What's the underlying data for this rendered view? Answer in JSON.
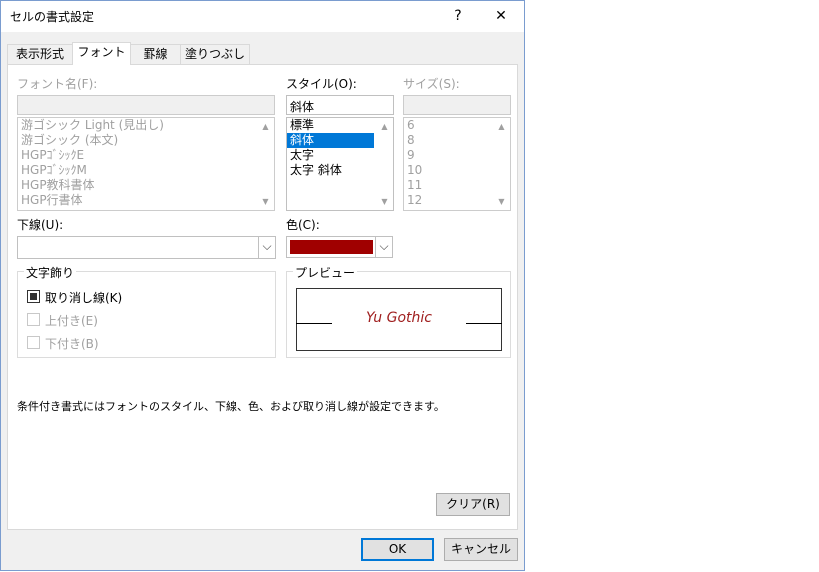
{
  "window": {
    "title": "セルの書式設定",
    "help_label": "?",
    "close_label": "✕"
  },
  "tabs": [
    {
      "label": "表示形式",
      "active": false
    },
    {
      "label": "フォント",
      "active": true
    },
    {
      "label": "罫線",
      "active": false
    },
    {
      "label": "塗りつぶし",
      "active": false
    }
  ],
  "font_name": {
    "label": "フォント名(F):",
    "value": "",
    "items": [
      "游ゴシック Light (見出し)",
      "游ゴシック (本文)",
      "HGPｺﾞｼｯｸE",
      "HGPｺﾞｼｯｸM",
      "HGP教科書体",
      "HGP行書体"
    ]
  },
  "style": {
    "label": "スタイル(O):",
    "value": "斜体",
    "items": [
      "標準",
      "斜体",
      "太字",
      "太字 斜体"
    ],
    "selected_index": 1
  },
  "size": {
    "label": "サイズ(S):",
    "value": "",
    "items": [
      "6",
      "8",
      "9",
      "10",
      "11",
      "12"
    ]
  },
  "underline": {
    "label": "下線(U):",
    "value": ""
  },
  "color": {
    "label": "色(C):",
    "value_hex": "#a00000"
  },
  "effects": {
    "title": "文字飾り",
    "strikethrough": {
      "label": "取り消し線(K)",
      "state": "indeterminate"
    },
    "superscript": {
      "label": "上付き(E)",
      "state": "disabled"
    },
    "subscript": {
      "label": "下付き(B)",
      "state": "disabled"
    }
  },
  "preview": {
    "title": "プレビュー",
    "text": "Yu Gothic",
    "text_color": "#a02020"
  },
  "info_text": "条件付き書式にはフォントのスタイル、下線、色、および取り消し線が設定できます。",
  "buttons": {
    "clear": "クリア(R)",
    "ok": "OK",
    "cancel": "キャンセル"
  },
  "colors": {
    "accent": "#0078d7",
    "dialog_bg": "#f0f0f0"
  }
}
